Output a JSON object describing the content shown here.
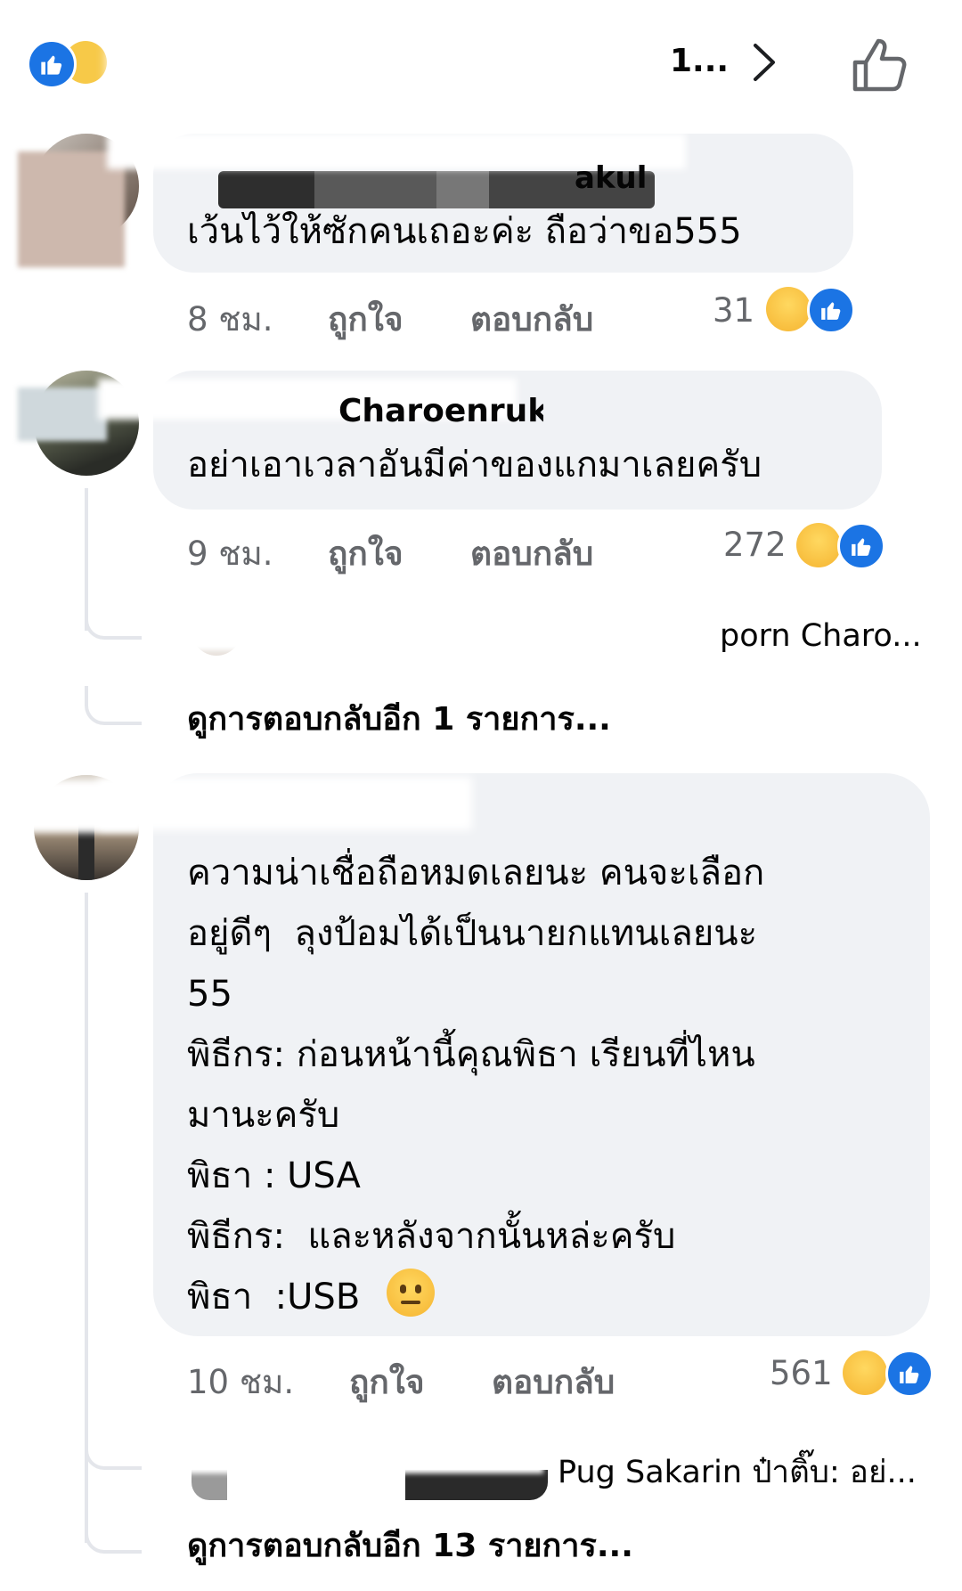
{
  "header": {
    "truncated_label": "1...",
    "icons": {
      "like": "like-reaction-icon",
      "haha": "haha-reaction-icon",
      "chevron": "chevron-right-icon",
      "thumb": "thumbs-up-outline-icon"
    }
  },
  "comments": [
    {
      "name_visible": "akul",
      "text": "เว้นไว้ให้ซักคนเถอะค่ะ ถือว่าขอ555",
      "time": "8 ชม.",
      "like_label": "ถูกใจ",
      "reply_label": "ตอบกลับ",
      "reaction_count": "31"
    },
    {
      "name_visible": "Charoenruk",
      "text": "อย่าเอาเวลาอันมีค่าของแกมาเลยครับ",
      "time": "9 ชม.",
      "like_label": "ถูกใจ",
      "reply_label": "ตอบกลับ",
      "reaction_count": "272",
      "reply_preview": "porn Charo...",
      "more_replies": "ดูการตอบกลับอีก 1 รายการ..."
    },
    {
      "lines": [
        "ความน่าเชื่อถือหมดเลยนะ คนจะเลือก",
        "อยู่ดีๆ  ลุงป้อมได้เป็นนายกแทนเลยนะ",
        "55",
        "พิธีกร: ก่อนหน้านี้คุณพิธา เรียนที่ไหน",
        "มานะครับ",
        "พิธา : USA",
        "พิธีกร:  และหลังจากนั้นหล่ะครับ",
        "พิธา  :USB"
      ],
      "time": "10 ชม.",
      "like_label": "ถูกใจ",
      "reply_label": "ตอบกลับ",
      "reaction_count": "561",
      "reply_preview": "Pug Sakarin ป๋าติ๊บ: อย่...",
      "more_replies": "ดูการตอบกลับอีก 13 รายการ..."
    }
  ]
}
